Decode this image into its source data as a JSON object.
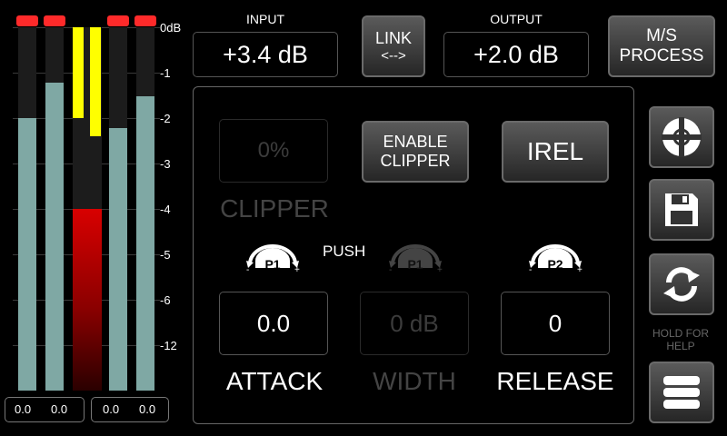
{
  "meters": {
    "scale": [
      "0dB",
      "-1",
      "-2",
      "-3",
      "-4",
      "-5",
      "-6",
      "-12"
    ],
    "readouts_left": [
      "0.0",
      "0.0"
    ],
    "readouts_right": [
      "0.0",
      "0.0"
    ]
  },
  "input": {
    "label": "INPUT",
    "value": "+3.4 dB"
  },
  "link": {
    "line1": "LINK",
    "line2": "<-->"
  },
  "output": {
    "label": "OUTPUT",
    "value": "+2.0 dB"
  },
  "ms_process": {
    "line1": "M/S",
    "line2": "PROCESS"
  },
  "clipper": {
    "value": "0%",
    "label": "CLIPPER"
  },
  "enable_clipper": {
    "line1": "ENABLE",
    "line2": "CLIPPER"
  },
  "irel": {
    "label": "IREL"
  },
  "push_label": "PUSH",
  "knobs": {
    "p1": "P1",
    "p1_dim": "P1",
    "p2": "P2"
  },
  "attack": {
    "value": "0.0",
    "label": "ATTACK"
  },
  "width": {
    "value": "0 dB",
    "label": "WIDTH"
  },
  "release": {
    "value": "0",
    "label": "RELEASE"
  },
  "help_text": {
    "line1": "HOLD FOR",
    "line2": "HELP"
  },
  "colors": {
    "peak": "#ff2a2a",
    "meter_fill": "#7fa8a4",
    "gain_reduction": "#ffff00",
    "clip_red": "#d80000"
  }
}
